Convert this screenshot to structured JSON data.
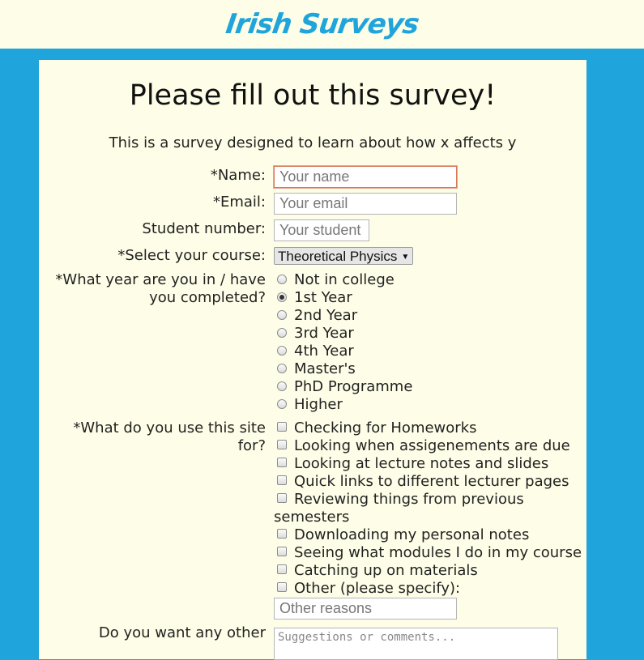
{
  "header": {
    "brand": "Irish Surveys"
  },
  "form": {
    "title": "Please fill out this survey!",
    "subtitle": "This is a survey designed to learn about how x affects y",
    "name": {
      "label": "*Name:",
      "placeholder": "Your name"
    },
    "email": {
      "label": "*Email:",
      "placeholder": "Your email"
    },
    "student_number": {
      "label": "Student number:",
      "placeholder": "Your student"
    },
    "course": {
      "label": "*Select your course:",
      "selected": "Theoretical Physics"
    },
    "year": {
      "label_line1": "*What year are you in / have",
      "label_line2": "you completed?",
      "options": [
        "Not in college",
        "1st Year",
        "2nd Year",
        "3rd Year",
        "4th Year",
        "Master's",
        "PhD Programme",
        "Higher"
      ],
      "selected": "1st Year"
    },
    "uses": {
      "label_line1": "*What do you use this site",
      "label_line2": "for?",
      "options": [
        "Checking for Homeworks",
        "Looking when assigenements are due",
        "Looking at lecture notes and slides",
        "Quick links to different lecturer pages",
        "Reviewing things from previous",
        "semesters",
        "Downloading my personal notes",
        "Seeing what modules I do in my course",
        "Catching up on materials",
        "Other (please specify):"
      ],
      "other_placeholder": "Other reasons"
    },
    "comments": {
      "label": "Do you want any other",
      "placeholder": "Suggestions or comments..."
    }
  },
  "colors": {
    "accent": "#1fa5db",
    "card_bg": "#fefee8"
  }
}
